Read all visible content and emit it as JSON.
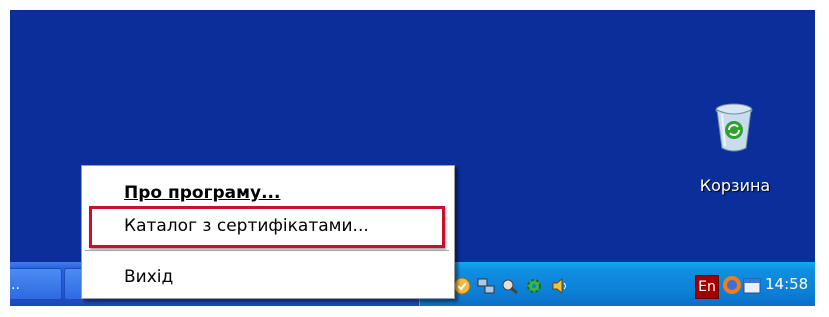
{
  "desktop": {
    "recycle_bin_label": "Корзина"
  },
  "taskbar": {
    "task_button_label": "..",
    "clock": "14:58",
    "language": "En",
    "tray_icons": [
      "network-icon",
      "clock-app-icon",
      "network-connections-icon",
      "tools-icon",
      "gear-icon",
      "volume-icon",
      "language-indicator",
      "firefox-icon",
      "calendar-icon"
    ]
  },
  "context_menu": {
    "items": [
      {
        "label": "Про програму..."
      },
      {
        "label": "Каталог з сертифікатами..."
      },
      {
        "label": "Вихід"
      }
    ]
  },
  "colors": {
    "desktop": "#0b2e9a",
    "taskbar": "#2458d3",
    "tray": "#0c7fd6",
    "highlight": "#c8102e"
  }
}
